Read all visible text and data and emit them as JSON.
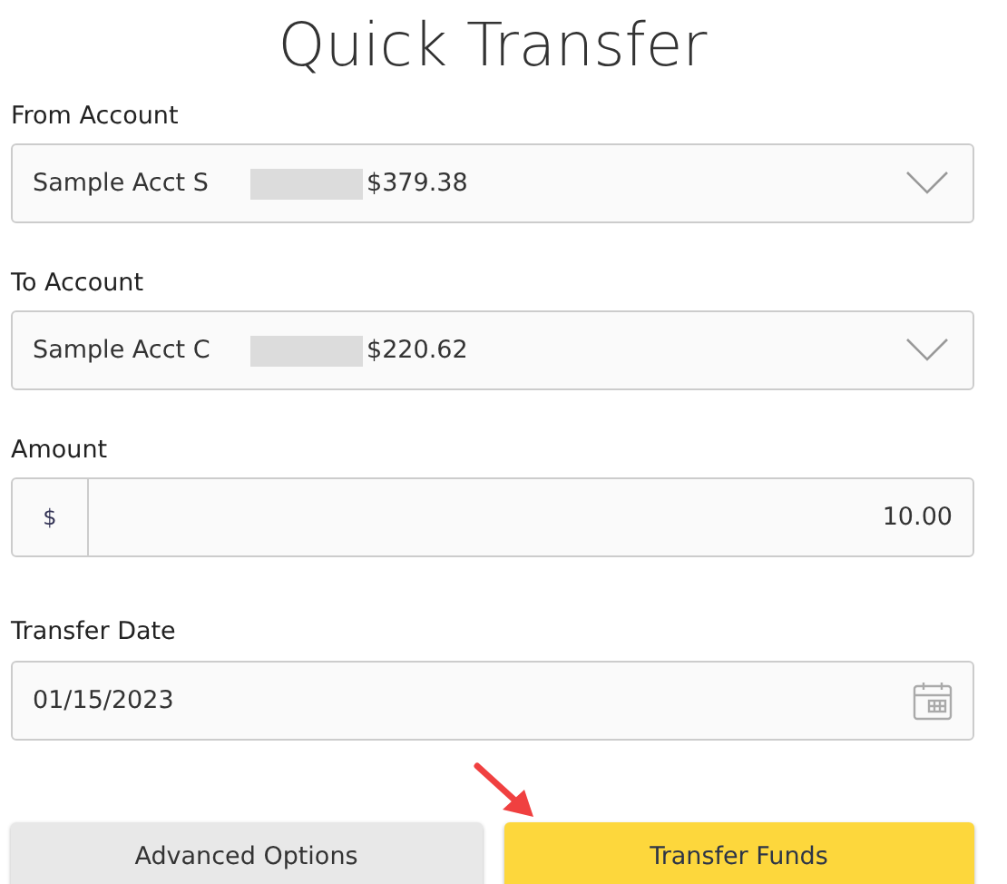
{
  "title": "Quick Transfer",
  "from_account": {
    "label": "From Account",
    "account": "Sample Acct S",
    "balance": "$379.38"
  },
  "to_account": {
    "label": "To Account",
    "account": "Sample Acct C",
    "balance": "$220.62"
  },
  "amount": {
    "label": "Amount",
    "prefix": "$",
    "value": "10.00"
  },
  "transfer_date": {
    "label": "Transfer Date",
    "value": "01/15/2023"
  },
  "buttons": [
    {
      "label": "Advanced Options",
      "kind": "secondary"
    },
    {
      "label": "Transfer Funds",
      "kind": "primary"
    }
  ]
}
